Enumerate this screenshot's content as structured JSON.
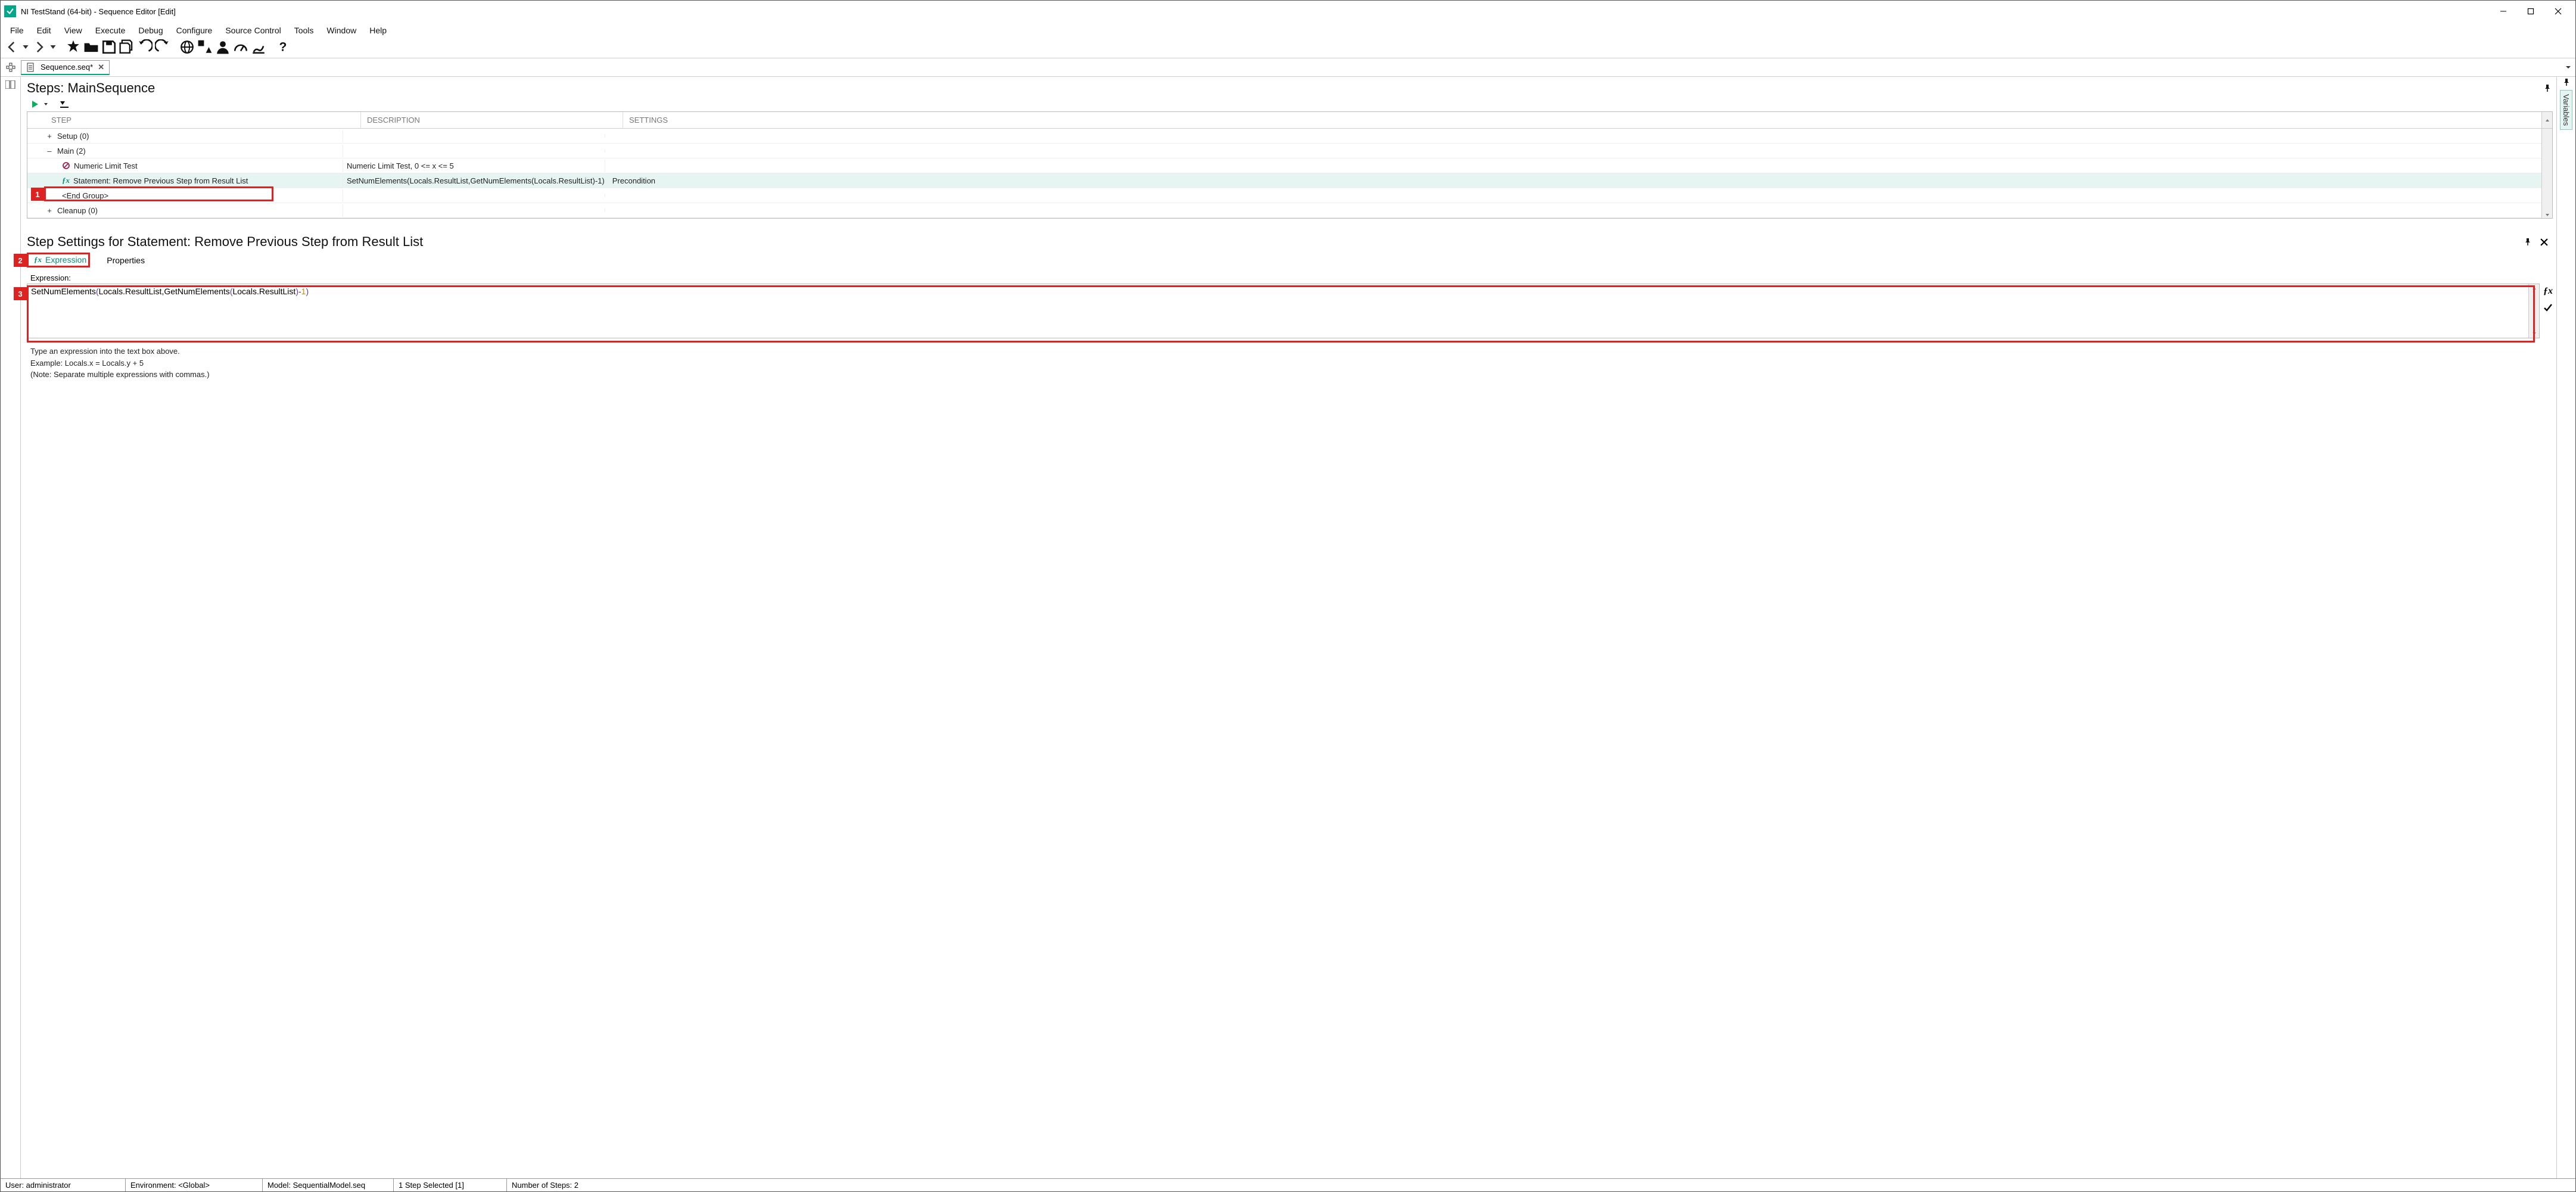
{
  "titlebar": {
    "title": "NI TestStand (64-bit) - Sequence Editor [Edit]"
  },
  "menus": [
    "File",
    "Edit",
    "View",
    "Execute",
    "Debug",
    "Configure",
    "Source Control",
    "Tools",
    "Window",
    "Help"
  ],
  "doctab": {
    "name": "Sequence.seq*"
  },
  "steps_panel": {
    "title": "Steps: MainSequence",
    "columns": {
      "step": "STEP",
      "desc": "DESCRIPTION",
      "settings": "SETTINGS"
    },
    "rows": {
      "setup": {
        "toggle": "+",
        "label": "Setup (0)"
      },
      "main": {
        "toggle": "–",
        "label": "Main (2)"
      },
      "numtest": {
        "label": "Numeric Limit Test",
        "desc": "Numeric Limit Test,  0 <= x <= 5"
      },
      "stmt": {
        "label": "Statement: Remove Previous Step from Result List",
        "desc": "SetNumElements(Locals.ResultList,GetNumElements(Locals.ResultList)-1)",
        "settings": "Precondition"
      },
      "endgrp": {
        "label": "<End Group>"
      },
      "cleanup": {
        "toggle": "+",
        "label": "Cleanup (0)"
      }
    }
  },
  "settings_panel": {
    "title": "Step Settings for Statement: Remove Previous Step from Result List",
    "tabs": {
      "expression": "Expression",
      "properties": "Properties"
    },
    "expr_label": "Expression:",
    "expression_tokens": {
      "fn1": "SetNumElements",
      "lp1": "(",
      "p1": "Locals.ResultList",
      "comma": ",",
      "fn2": "GetNumElements",
      "lp2": "(",
      "p2": "Locals.ResultList",
      "rp2": ")",
      "minus": "-",
      "num": "1",
      "rp1": ")"
    },
    "hint1": "Type an expression into the text box above.",
    "hint2": "Example: Locals.x = Locals.y + 5",
    "hint3": "(Note: Separate multiple expressions with commas.)"
  },
  "callouts": {
    "c1": "1",
    "c2": "2",
    "c3": "3"
  },
  "variables_tab": "Variables",
  "statusbar": {
    "user": "User: administrator",
    "env": "Environment: <Global>",
    "model": "Model: SequentialModel.seq",
    "sel": "1 Step Selected [1]",
    "count": "Number of Steps: 2"
  }
}
